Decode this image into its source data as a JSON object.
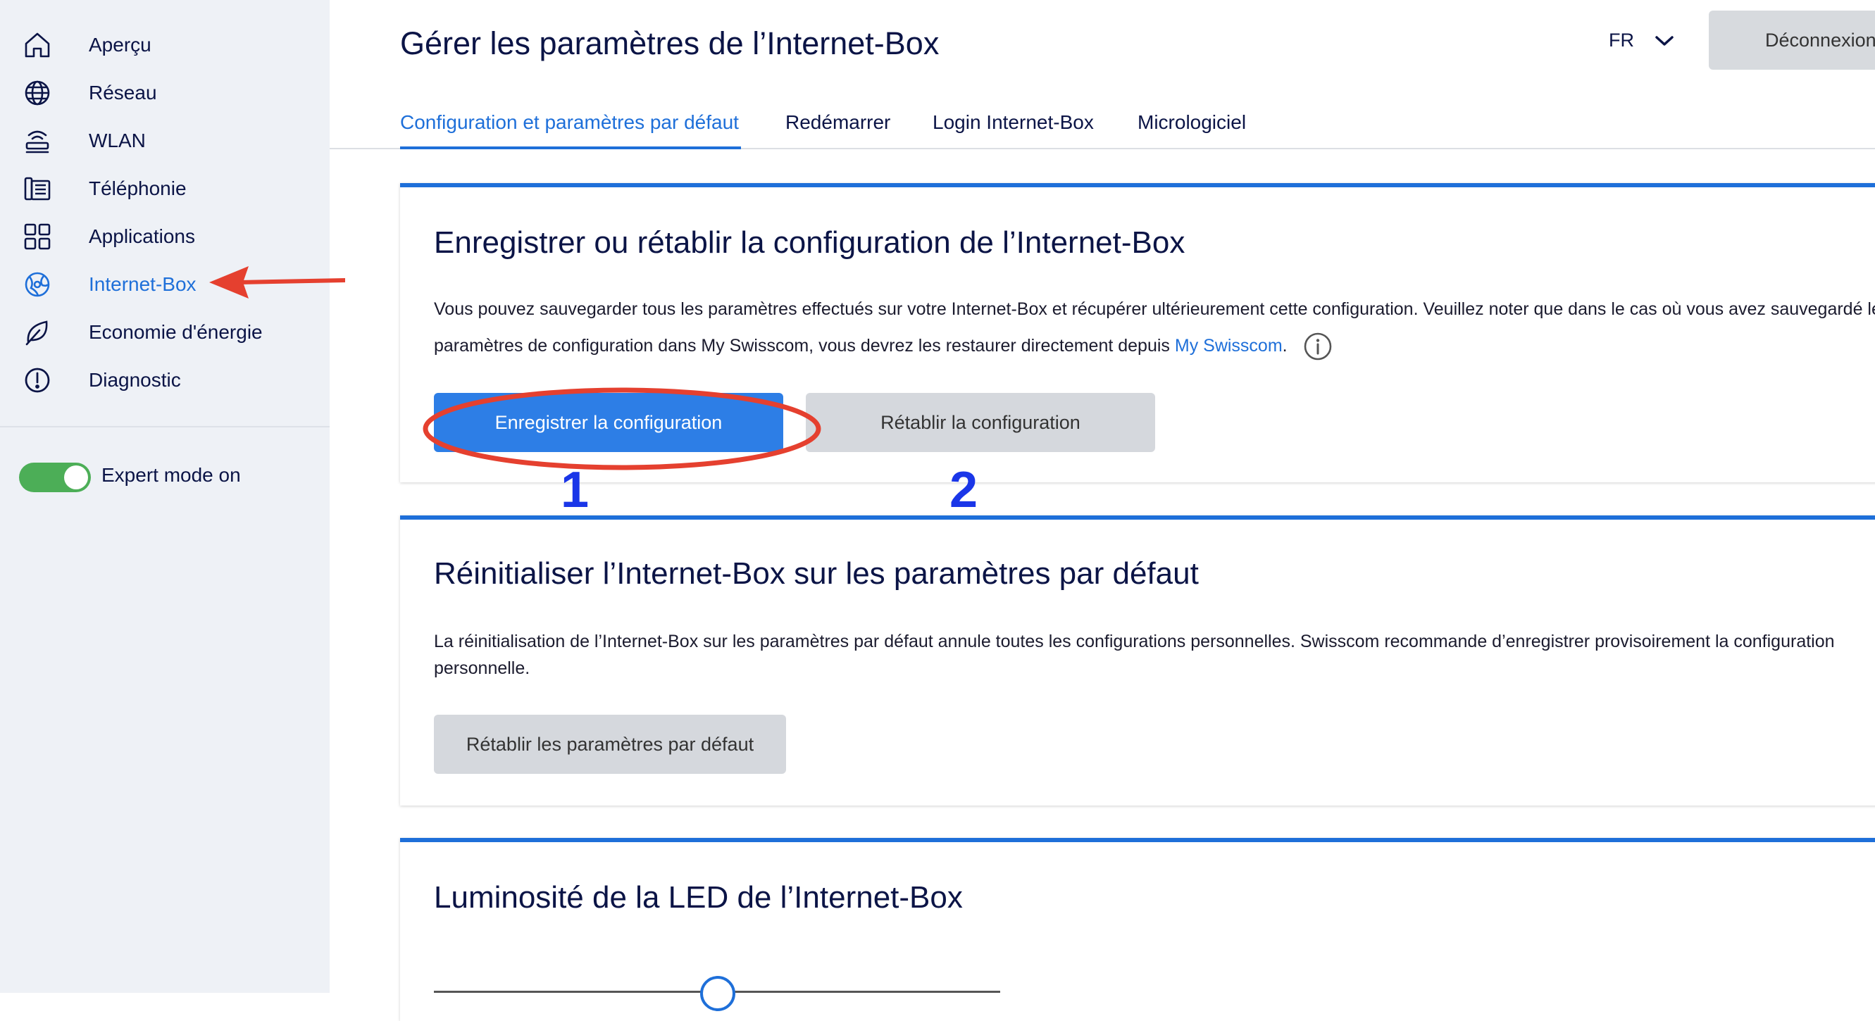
{
  "sidebar": {
    "items": [
      {
        "label": "Aperçu",
        "icon": "home-icon"
      },
      {
        "label": "Réseau",
        "icon": "globe-icon"
      },
      {
        "label": "WLAN",
        "icon": "router-icon"
      },
      {
        "label": "Téléphonie",
        "icon": "phone-icon"
      },
      {
        "label": "Applications",
        "icon": "apps-icon"
      },
      {
        "label": "Internet-Box",
        "icon": "internet-box-icon",
        "active": true
      },
      {
        "label": "Economie d'énergie",
        "icon": "leaf-icon"
      },
      {
        "label": "Diagnostic",
        "icon": "alert-icon"
      }
    ],
    "expert_mode_label": "Expert mode on",
    "expert_mode_on": true
  },
  "header": {
    "title": "Gérer les paramètres de l’Internet-Box",
    "language": "FR",
    "logout_label": "Déconnexion"
  },
  "tabs": [
    {
      "label": "Configuration et paramètres par défaut",
      "active": true
    },
    {
      "label": "Redémarrer"
    },
    {
      "label": "Login Internet-Box"
    },
    {
      "label": "Micrologiciel"
    }
  ],
  "cards": {
    "save_restore": {
      "title": "Enregistrer ou rétablir la configuration de l’Internet-Box",
      "text_line1": "Vous pouvez sauvegarder tous les paramètres effectués sur votre Internet-Box et récupérer ultérieurement cette configuration. Veuillez noter que dans le cas où vous avez sauvegardé les",
      "text_line2_prefix": "paramètres de configuration dans My Swisscom, vous devrez les restaurer directement depuis ",
      "link_label": "My Swisscom",
      "text_line2_suffix": ".",
      "save_button": "Enregistrer la configuration",
      "restore_button": "Rétablir la configuration"
    },
    "reset": {
      "title": "Réinitialiser l’Internet-Box sur les paramètres par défaut",
      "text_line1": "La réinitialisation de l’Internet-Box sur les paramètres par défaut annule toutes les configurations personnelles. Swisscom recommande d’enregistrer provisoirement la configuration",
      "text_line2": "personnelle.",
      "reset_button": "Rétablir les paramètres par défaut"
    },
    "led": {
      "title": "Luminosité de la LED de l’Internet-Box"
    }
  },
  "annotations": {
    "step1": "1",
    "step2": "2",
    "arrow_color": "#e5402f",
    "circle_color": "#e5402f",
    "step_color": "#1a36e8"
  },
  "colors": {
    "accent": "#1e6fd9",
    "primary_button": "#2d7ee6",
    "secondary_button": "#d5d8dd",
    "toggle_on": "#4cae57",
    "sidebar_bg": "#eef1f6"
  }
}
